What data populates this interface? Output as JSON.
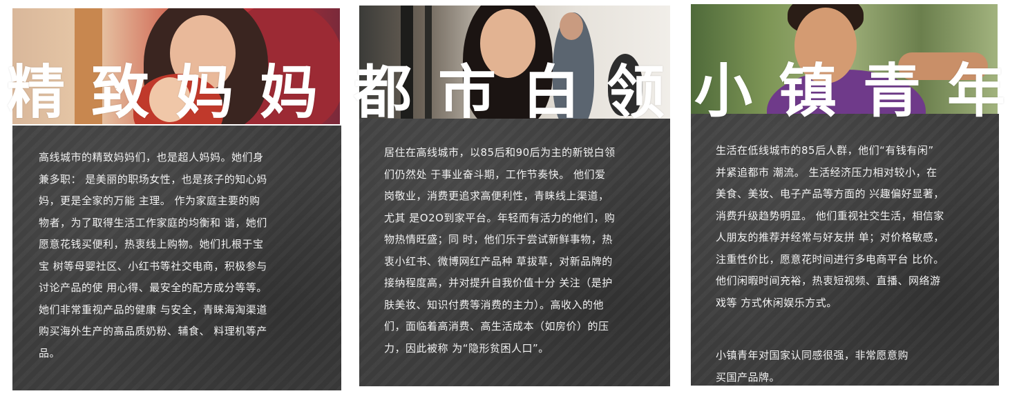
{
  "cards": [
    {
      "title": "精致妈妈",
      "description": "高线城市的精致妈妈们，也是超人妈妈。她们身\n兼多职： 是美丽的职场女性，也是孩子的知心妈\n妈，更是全家的万能 主理。 作为家庭主要的购\n物者，为了取得生活工作家庭的均衡和 谐，她们\n愿意花钱买便利，热衷线上购物。她们扎根于宝\n宝 树等母婴社区、小红书等社交电商，积极参与\n讨论产品的使 用心得、最安全的配方成分等等。\n她们非常重视产品的健康 与安全，青睐海淘渠道\n购买海外生产的高品质奶粉、辅食、 料理机等产\n品。"
    },
    {
      "title": "都市白领",
      "description": "居住在高线城市，以85后和90后为主的新锐白领\n们仍然处 于事业奋斗期，工作节奏快。 他们爱\n岗敬业，消费更追求高便利性，青睐线上渠道，\n尤其 是O2O到家平台。年轻而有活力的他们，购\n物热情旺盛；同 时，他们乐于尝试新鲜事物，热\n衷小红书、微博网红产品种 草拔草，对新品牌的\n接纳程度高，并对提升自我价值十分 关注（是护\n肤美妆、知识付费等消费的主力）。高收入的他\n们，面临着高消费、高生活成本（如房价）的压\n力，因此被称 为“隐形贫困人口”。"
    },
    {
      "title": "小镇青年",
      "description": "生活在低线城市的85后人群，他们“有钱有闲”\n并紧追都市 潮流。 生活经济压力相对较小，在\n美食、美妆、电子产品等方面的 兴趣偏好显著，\n消费升级趋势明显。 他们重视社交生活，相信家\n人朋友的推荐并经常与好友拼 单；对价格敏感，\n注重性价比，愿意花时间进行多电商平台 比价。\n他们闲暇时间充裕，热衷短视频、直播、网络游\n戏等 方式休闲娱乐方式。",
      "description2": "小镇青年对国家认同感很强，非常愿意购\n买国产品牌。"
    }
  ]
}
